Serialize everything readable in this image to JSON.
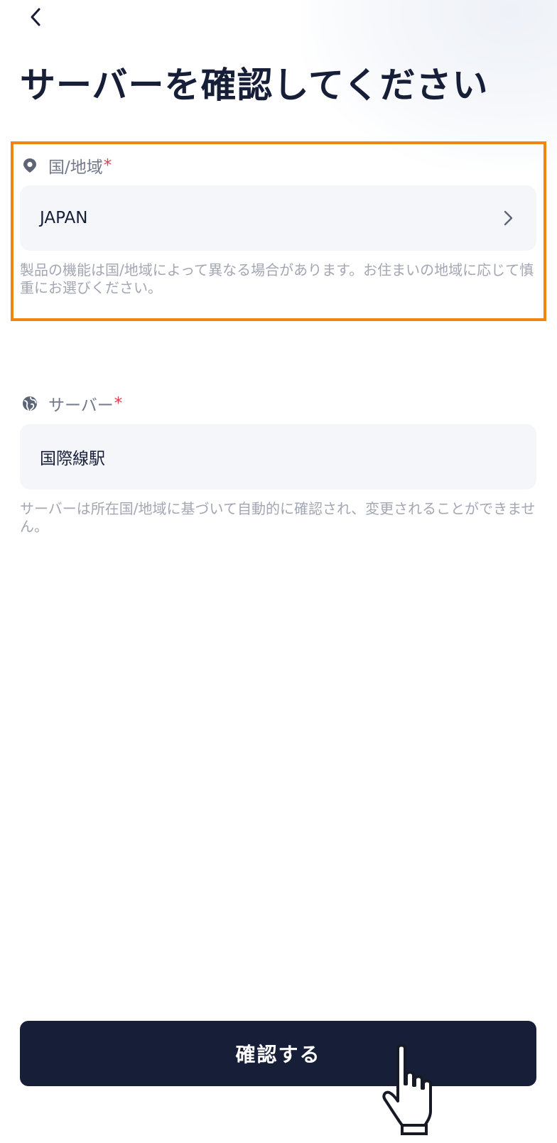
{
  "header": {
    "title": "サーバーを確認してください"
  },
  "icons": {
    "back": "chevron-left-icon",
    "region": "location-pin-icon",
    "server": "globe-icon",
    "region_chevron": "chevron-right-icon",
    "pointer": "hand-pointer-icon"
  },
  "region_field": {
    "label": "国/地域",
    "required_mark": "*",
    "value": "JAPAN",
    "hint": "製品の機能は国/地域によって異なる場合があります。お住まいの地域に応じて慎重にお選びください。"
  },
  "server_field": {
    "label": "サーバー",
    "required_mark": "*",
    "value": "国際線駅",
    "hint": "サーバーは所在国/地域に基づいて自動的に確認され、変更されることができません。"
  },
  "footer": {
    "confirm_label": "確認する"
  },
  "colors": {
    "primary": "#161e38",
    "highlight": "#f0860f",
    "required": "#e83a4a",
    "field_bg": "#f5f6f9",
    "hint_text": "#a2a7b3"
  }
}
